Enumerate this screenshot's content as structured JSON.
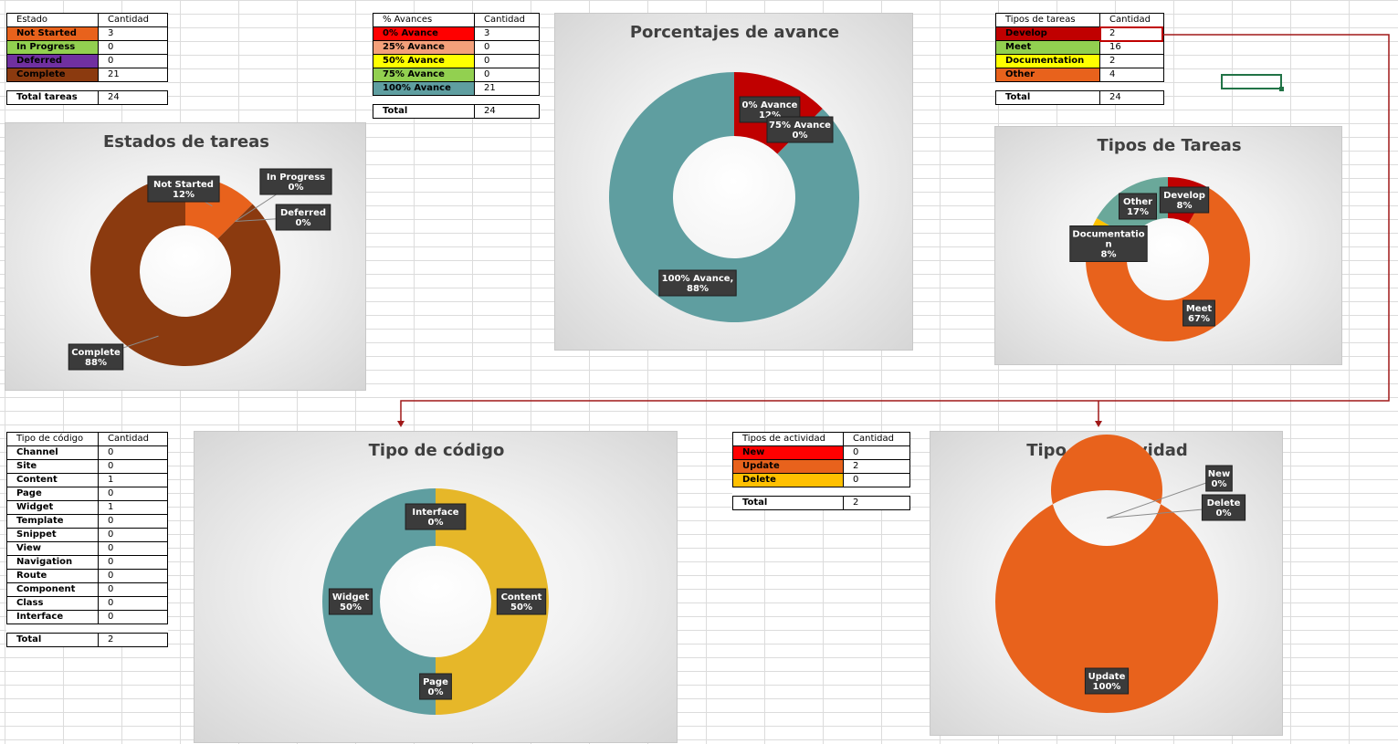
{
  "tables": {
    "estado": {
      "header": [
        "Estado",
        "Cantidad"
      ],
      "rows": [
        {
          "label": "Not Started",
          "value": "3",
          "color": "#e8621c"
        },
        {
          "label": "In Progress",
          "value": "0",
          "color": "#92d050"
        },
        {
          "label": "Deferred",
          "value": "0",
          "color": "#7030a0"
        },
        {
          "label": "Complete",
          "value": "21",
          "color": "#8b3a0f"
        }
      ],
      "total_label": "Total tareas",
      "total_value": "24"
    },
    "avances": {
      "header": [
        "% Avances",
        "Cantidad"
      ],
      "rows": [
        {
          "label": "0% Avance",
          "value": "3",
          "color": "#ff0000"
        },
        {
          "label": "25% Avance",
          "value": "0",
          "color": "#f4a07a"
        },
        {
          "label": "50% Avance",
          "value": "0",
          "color": "#ffff00"
        },
        {
          "label": "75% Avance",
          "value": "0",
          "color": "#92d050"
        },
        {
          "label": "100% Avance",
          "value": "21",
          "color": "#5f9ea0"
        }
      ],
      "total_label": "Total",
      "total_value": "24"
    },
    "tipos_tareas": {
      "header": [
        "Tipos de tareas",
        "Cantidad"
      ],
      "rows": [
        {
          "label": "Develop",
          "value": "2",
          "color": "#c00000"
        },
        {
          "label": "Meet",
          "value": "16",
          "color": "#92d050"
        },
        {
          "label": "Documentation",
          "value": "2",
          "color": "#ffff00"
        },
        {
          "label": "Other",
          "value": "4",
          "color": "#e8621c"
        }
      ],
      "total_label": "Total",
      "total_value": "24"
    },
    "tipo_codigo": {
      "header": [
        "Tipo de código",
        "Cantidad"
      ],
      "rows": [
        {
          "label": "Channel",
          "value": "0"
        },
        {
          "label": "Site",
          "value": "0"
        },
        {
          "label": "Content",
          "value": "1"
        },
        {
          "label": "Page",
          "value": "0"
        },
        {
          "label": "Widget",
          "value": "1"
        },
        {
          "label": "Template",
          "value": "0"
        },
        {
          "label": "Snippet",
          "value": "0"
        },
        {
          "label": "View",
          "value": "0"
        },
        {
          "label": "Navigation",
          "value": "0"
        },
        {
          "label": "Route",
          "value": "0"
        },
        {
          "label": "Component",
          "value": "0"
        },
        {
          "label": "Class",
          "value": "0"
        },
        {
          "label": "Interface",
          "value": "0"
        }
      ],
      "total_label": "Total",
      "total_value": "2"
    },
    "tipos_actividad": {
      "header": [
        "Tipos de actividad",
        "Cantidad"
      ],
      "rows": [
        {
          "label": "New",
          "value": "0",
          "color": "#ff0000"
        },
        {
          "label": "Update",
          "value": "2",
          "color": "#e8621c"
        },
        {
          "label": "Delete",
          "value": "0",
          "color": "#ffc000"
        }
      ],
      "total_label": "Total",
      "total_value": "2"
    }
  },
  "chart_data": [
    {
      "id": "estados",
      "type": "pie",
      "title": "Estados de tareas",
      "categories": [
        "Not Started",
        "In Progress",
        "Deferred",
        "Complete"
      ],
      "values": [
        3,
        0,
        0,
        21
      ],
      "colors": [
        "#e8621c",
        "#92d050",
        "#7030a0",
        "#8b3a0f"
      ],
      "labels": [
        {
          "text": [
            "Not Started",
            "12%"
          ]
        },
        {
          "text": [
            "In Progress",
            "0%"
          ]
        },
        {
          "text": [
            "Deferred",
            "0%"
          ]
        },
        {
          "text": [
            "Complete",
            "88%"
          ]
        }
      ]
    },
    {
      "id": "avances",
      "type": "pie",
      "title": "Porcentajes de avance",
      "categories": [
        "0% Avance",
        "25% Avance",
        "50% Avance",
        "75% Avance",
        "100% Avance"
      ],
      "values": [
        3,
        0,
        0,
        0,
        21
      ],
      "colors": [
        "#c00000",
        "#f4a07a",
        "#ffff00",
        "#92d050",
        "#5f9ea0"
      ],
      "labels": [
        {
          "text": [
            "0% Avance",
            "12%"
          ]
        },
        null,
        null,
        {
          "text": [
            "75% Avance",
            "0%"
          ]
        },
        {
          "text": [
            "100% Avance,",
            "88%"
          ]
        }
      ]
    },
    {
      "id": "tipos_tareas",
      "type": "pie",
      "title": "Tipos de Tareas",
      "categories": [
        "Develop",
        "Meet",
        "Documentation",
        "Other"
      ],
      "values": [
        2,
        16,
        2,
        4
      ],
      "colors": [
        "#c00000",
        "#e8621c",
        "#ffc000",
        "#6aa89a"
      ],
      "labels": [
        {
          "text": [
            "Develop",
            "8%"
          ]
        },
        {
          "text": [
            "Meet",
            "67%"
          ]
        },
        {
          "text": [
            "Documentatio",
            "n",
            "8%"
          ]
        },
        {
          "text": [
            "Other",
            "17%"
          ]
        }
      ]
    },
    {
      "id": "tipo_codigo",
      "type": "pie",
      "title": "Tipo de código",
      "categories": [
        "Content",
        "Page",
        "Widget",
        "Interface"
      ],
      "values": [
        1,
        0,
        1,
        0
      ],
      "colors": [
        "#e6b729",
        "#f4a07a",
        "#5f9ea0",
        "#7030a0"
      ],
      "labels": [
        {
          "text": [
            "Content",
            "50%"
          ]
        },
        {
          "text": [
            "Page",
            "0%"
          ]
        },
        {
          "text": [
            "Widget",
            "50%"
          ]
        },
        {
          "text": [
            "Interface",
            "0%"
          ]
        }
      ]
    },
    {
      "id": "tipo_actividad",
      "type": "pie",
      "title": "Tipo de Actividad",
      "categories": [
        "New",
        "Update",
        "Delete"
      ],
      "values": [
        0,
        2,
        0
      ],
      "colors": [
        "#ff0000",
        "#e8621c",
        "#ffc000"
      ],
      "labels": [
        {
          "text": [
            "New",
            "0%"
          ]
        },
        {
          "text": [
            "Update",
            "100%"
          ]
        },
        {
          "text": [
            "Delete",
            "0%"
          ]
        }
      ]
    }
  ]
}
